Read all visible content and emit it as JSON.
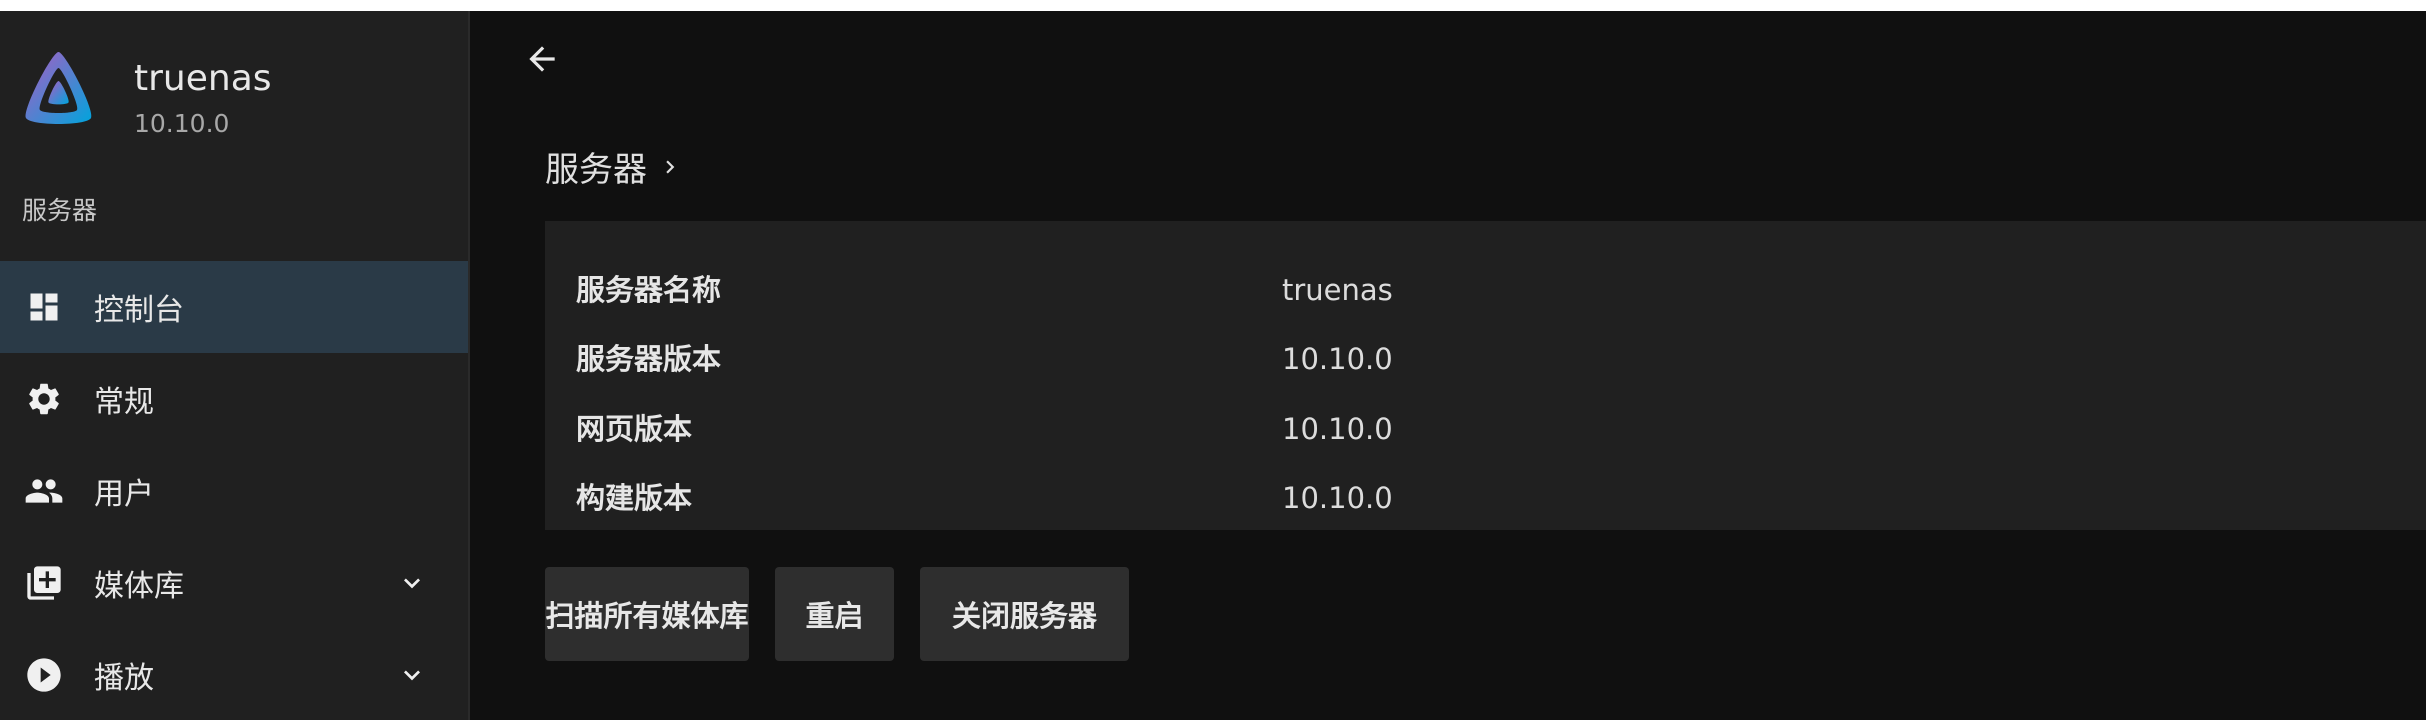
{
  "brand": {
    "name": "truenas",
    "version": "10.10.0"
  },
  "sidebar": {
    "section_header": "服务器",
    "items": [
      {
        "label": "控制台",
        "icon": "dashboard-icon",
        "active": true
      },
      {
        "label": "常规",
        "icon": "gear-icon",
        "active": false
      },
      {
        "label": "用户",
        "icon": "users-icon",
        "active": false
      },
      {
        "label": "媒体库",
        "icon": "library-add-icon",
        "active": false,
        "expandable": true
      },
      {
        "label": "播放",
        "icon": "play-circle-icon",
        "active": false,
        "expandable": true
      }
    ]
  },
  "main": {
    "section_title": "服务器",
    "info": [
      {
        "key": "服务器名称",
        "value": "truenas"
      },
      {
        "key": "服务器版本",
        "value": "10.10.0"
      },
      {
        "key": "网页版本",
        "value": "10.10.0"
      },
      {
        "key": "构建版本",
        "value": "10.10.0"
      }
    ],
    "actions": {
      "scan_label": "扫描所有媒体库",
      "restart_label": "重启",
      "shutdown_label": "关闭服务器"
    }
  },
  "colors": {
    "background": "#101010",
    "sidebar": "#202020",
    "active_item": "#2a3a47",
    "panel": "#202020",
    "button": "#2e2e2e",
    "logo_gradient_start": "#aa5cc3",
    "logo_gradient_end": "#00a4dc"
  }
}
